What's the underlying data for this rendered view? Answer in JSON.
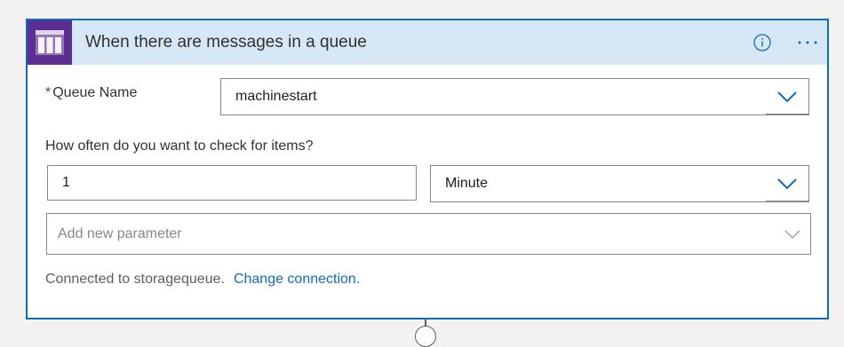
{
  "trigger": {
    "title": "When there are messages in a queue",
    "icon": "storage-queue-icon",
    "icon_color": "#5c2e91",
    "accent_color": "#0f6cbd",
    "header_color": "#d6e8f6"
  },
  "queue_name": {
    "required_mark": "*",
    "label": "Queue Name",
    "value": "machinestart"
  },
  "frequency": {
    "label": "How often do you want to check for items?",
    "interval_value": "1",
    "unit_value": "Minute"
  },
  "add_parameter": {
    "placeholder": "Add new parameter"
  },
  "connection": {
    "text": "Connected to storagequeue.",
    "change_link": "Change connection."
  }
}
